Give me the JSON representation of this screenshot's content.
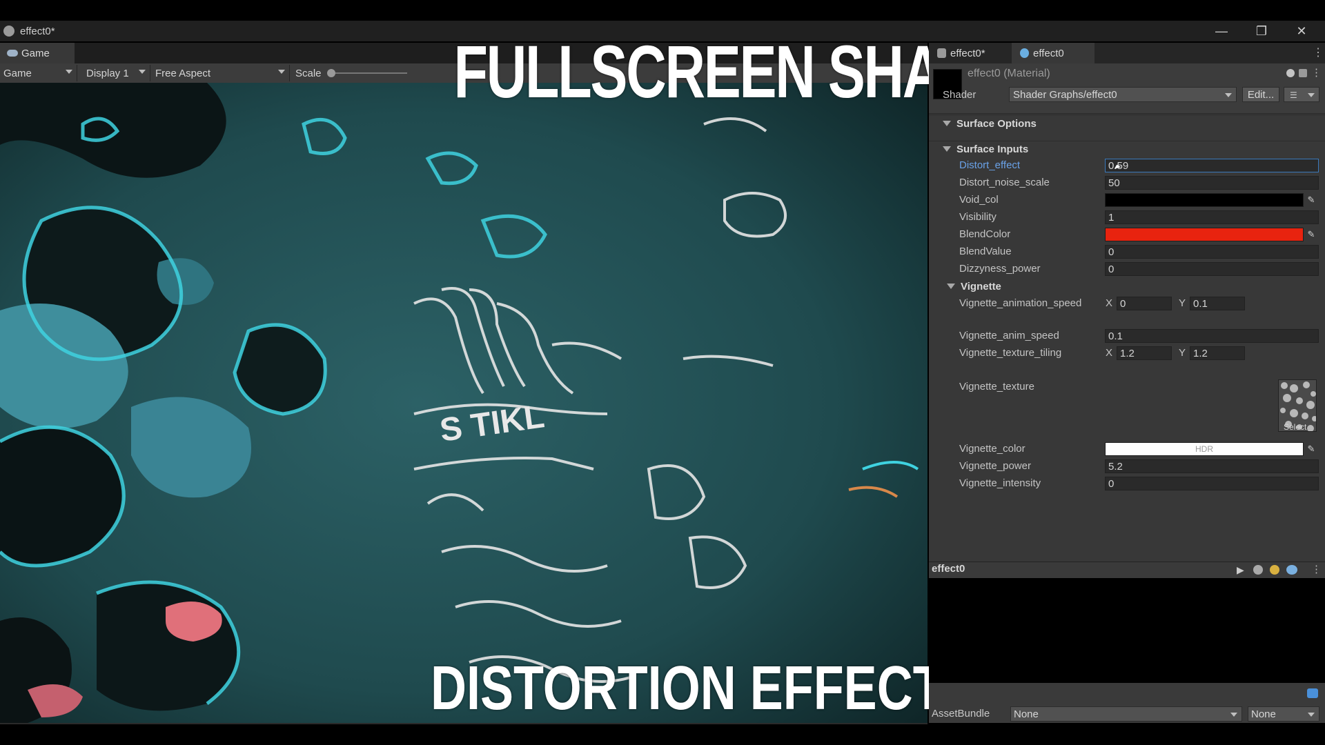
{
  "window": {
    "title": "effect0*"
  },
  "game_panel": {
    "tab_label": "Game",
    "toolbar": {
      "mode": "Game",
      "display": "Display 1",
      "aspect": "Free Aspect",
      "scale_label": "Scale"
    }
  },
  "overlay": {
    "headline": "FULLSCREEN SHADERS",
    "subline": "DISTORTION EFFECT"
  },
  "inspector": {
    "tabs": [
      {
        "label": "effect0*"
      },
      {
        "label": "effect0"
      }
    ],
    "material_title": "effect0 (Material)",
    "shader_label": "Shader",
    "shader_value": "Shader Graphs/effect0",
    "edit_label": "Edit...",
    "sections": {
      "surface_options": "Surface Options",
      "surface_inputs": "Surface Inputs",
      "vignette": "Vignette"
    },
    "properties": {
      "distort_effect": {
        "label": "Distort_effect",
        "value": "0.59"
      },
      "distort_noise_scale": {
        "label": "Distort_noise_scale",
        "value": "50"
      },
      "void_col": {
        "label": "Void_col",
        "color": "#000000"
      },
      "visibility": {
        "label": "Visibility",
        "value": "1"
      },
      "blend_color": {
        "label": "BlendColor",
        "color": "#e8230f"
      },
      "blend_value": {
        "label": "BlendValue",
        "value": "0"
      },
      "dizzyness_power": {
        "label": "Dizzyness_power",
        "value": "0"
      },
      "vignette_animation_speed": {
        "label": "Vignette_animation_speed",
        "x_label": "X",
        "x": "0",
        "y_label": "Y",
        "y": "0.1"
      },
      "vignette_anim_speed": {
        "label": "Vignette_anim_speed",
        "value": "0.1"
      },
      "vignette_texture_tiling": {
        "label": "Vignette_texture_tiling",
        "x_label": "X",
        "x": "1.2",
        "y_label": "Y",
        "y": "1.2"
      },
      "vignette_texture": {
        "label": "Vignette_texture",
        "select_label": "Select"
      },
      "vignette_color": {
        "label": "Vignette_color",
        "hdr_label": "HDR",
        "color": "#ffffff"
      },
      "vignette_power": {
        "label": "Vignette_power",
        "value": "5.2"
      },
      "vignette_intensity": {
        "label": "Vignette_intensity",
        "value": "0"
      }
    },
    "preview": {
      "title": "effect0"
    },
    "asset_bundle": {
      "label": "AssetBundle",
      "value": "None",
      "variant": "None"
    }
  },
  "colors": {
    "accent_blue": "#3a79bb",
    "active_label": "#6aa2e8",
    "panel_bg": "#383838",
    "viewport_teal": "#1f4a4d"
  }
}
